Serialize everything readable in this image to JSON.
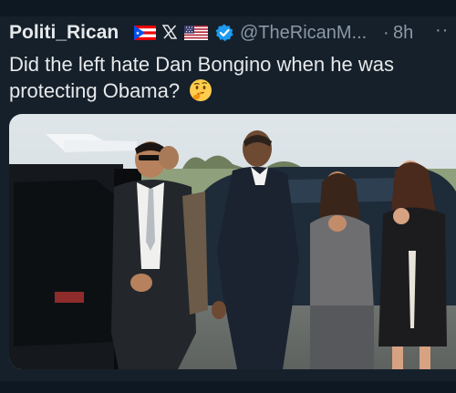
{
  "tweet": {
    "display_name": "Politi_Rican",
    "handle": "@TheRicanM...",
    "separator": "·",
    "time": "8h",
    "more": "··",
    "text": "Did the left hate Dan Bongino when he was protecting Obama?",
    "icons": [
      "puerto-rico-flag-icon",
      "x-logo-icon",
      "us-flag-icon",
      "verified-badge-icon",
      "thinking-face-emoji-icon",
      "more-options-icon"
    ],
    "colors": {
      "background": "#15202b",
      "text": "#e7e9ea",
      "muted": "#8b98a5",
      "verified": "#1d9bf0"
    }
  }
}
